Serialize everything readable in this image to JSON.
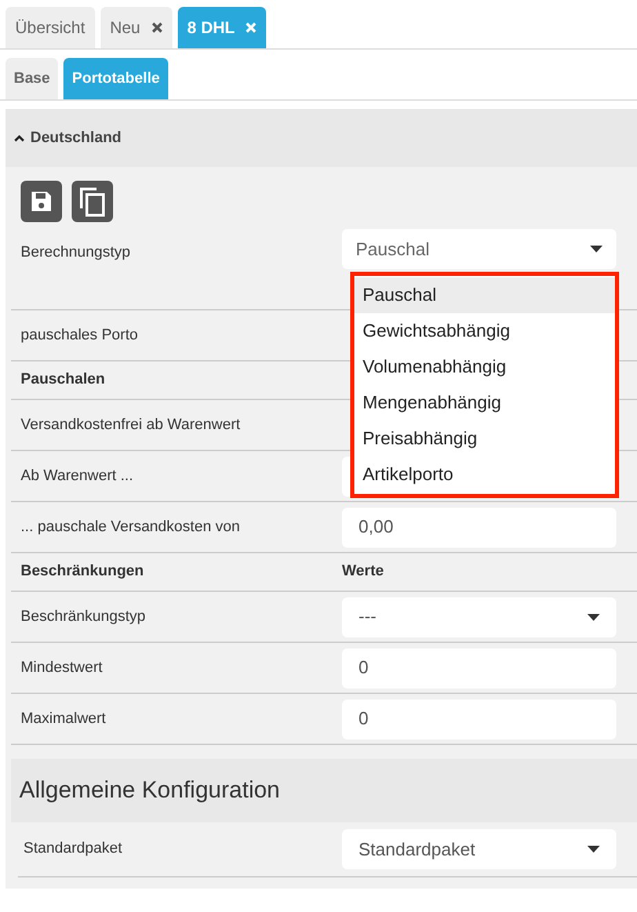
{
  "tabs": [
    {
      "label": "Übersicht",
      "selected": false,
      "closable": false
    },
    {
      "label": "Neu",
      "selected": false,
      "closable": true
    },
    {
      "label": "8 DHL",
      "selected": true,
      "closable": true
    }
  ],
  "subtabs": [
    {
      "label": "Base",
      "selected": false
    },
    {
      "label": "Portotabelle",
      "selected": true
    }
  ],
  "section": {
    "title": "Deutschland",
    "expanded": true,
    "berechnungstyp": {
      "label": "Berechnungstyp",
      "value": "Pauschal",
      "dropdown": [
        {
          "label": "Pauschal",
          "selected": true
        },
        {
          "label": "Gewichtsabhängig",
          "selected": false
        },
        {
          "label": "Volumenabhängig",
          "selected": false
        },
        {
          "label": "Mengenabhängig",
          "selected": false
        },
        {
          "label": "Preisabhängig",
          "selected": false
        },
        {
          "label": "Artikelporto",
          "selected": false
        }
      ]
    },
    "rows": [
      {
        "kind": "covered",
        "label": "pauschales Porto"
      },
      {
        "kind": "header",
        "label": "Pauschalen"
      },
      {
        "kind": "covered",
        "label": "Versandkostenfrei ab Warenwert"
      },
      {
        "kind": "input",
        "label": "Ab Warenwert ..."
      },
      {
        "kind": "input",
        "label": "... pauschale Versandkosten von",
        "value": "0,00"
      },
      {
        "kind": "header",
        "label": "Beschränkungen",
        "value": "Werte"
      },
      {
        "kind": "select",
        "label": "Beschränkungstyp",
        "value": "---"
      },
      {
        "kind": "input",
        "label": "Mindestwert",
        "value": "0"
      },
      {
        "kind": "input",
        "label": "Maximalwert",
        "value": "0"
      }
    ]
  },
  "general": {
    "title": "Allgemeine Konfiguration",
    "rows": [
      {
        "kind": "select",
        "label": "Standardpaket",
        "value": "Standardpaket"
      }
    ]
  }
}
